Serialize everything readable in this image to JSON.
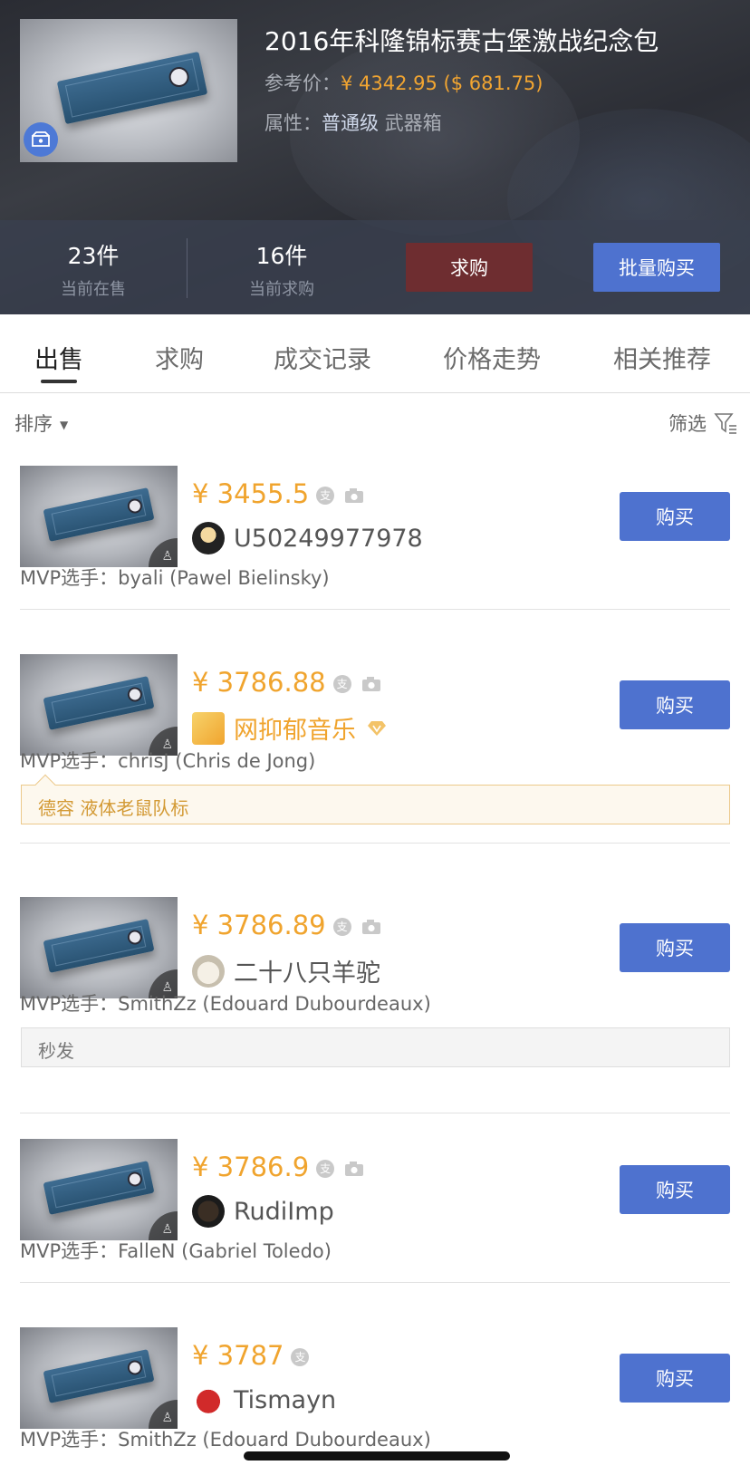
{
  "product": {
    "title": "2016年科隆锦标赛古堡激战纪念包",
    "price_label": "参考价：",
    "price_value": "¥ 4342.95 ($ 681.75)",
    "attr_label": "属性：",
    "attr_quality": "普通级",
    "attr_type": "武器箱"
  },
  "stats": {
    "on_sale_count": "23件",
    "on_sale_label": "当前在售",
    "wanted_count": "16件",
    "wanted_label": "当前求购",
    "seek_button": "求购",
    "bulk_button": "批量购买"
  },
  "tabs": [
    {
      "label": "出售"
    },
    {
      "label": "求购"
    },
    {
      "label": "成交记录"
    },
    {
      "label": "价格走势"
    },
    {
      "label": "相关推荐"
    }
  ],
  "sort_label": "排序",
  "filter_label": "筛选",
  "listings": [
    {
      "price": "¥ 3455.5",
      "seller": "U50249977978",
      "mvp": "MVP选手：byali (Pawel Bielinsky)",
      "buy": "购买"
    },
    {
      "price": "¥ 3786.88",
      "seller": "网抑郁音乐",
      "mvp": "MVP选手：chrisJ (Chris de Jong)",
      "note": "德容 液体老鼠队标",
      "buy": "购买"
    },
    {
      "price": "¥ 3786.89",
      "seller": "二十八只羊驼",
      "mvp": "MVP选手：SmithZz (Edouard Dubourdeaux)",
      "note": "秒发",
      "buy": "购买"
    },
    {
      "price": "¥ 3786.9",
      "seller": "RudiImp",
      "mvp": "MVP选手：FalleN (Gabriel Toledo)",
      "buy": "购买"
    },
    {
      "price": "¥ 3787",
      "seller": "Tismayn",
      "mvp": "MVP选手：SmithZz (Edouard Dubourdeaux)",
      "buy": "购买"
    }
  ],
  "colors": {
    "accent_blue": "#4e72cf",
    "price_orange": "#f0a42e",
    "seek_red": "#6e2d30"
  }
}
